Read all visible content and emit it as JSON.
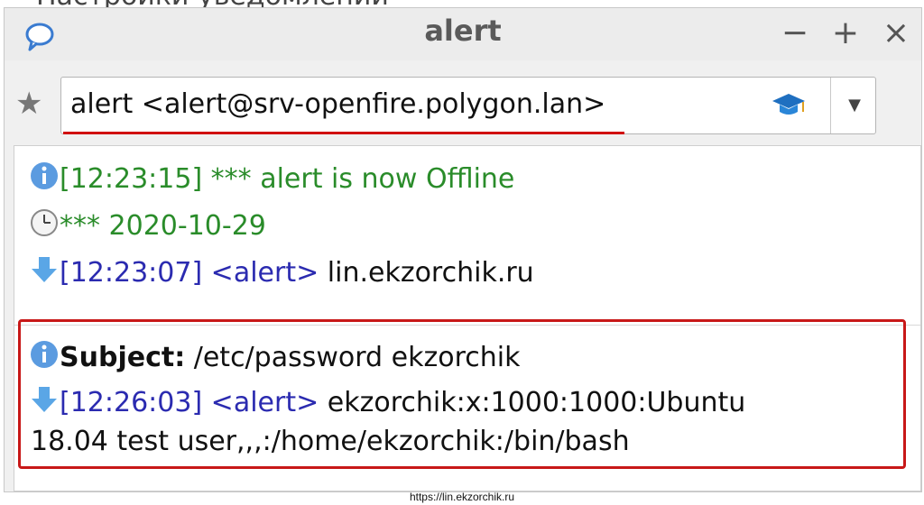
{
  "window": {
    "title": "alert",
    "controls": {
      "minimize": "−",
      "maximize": "+",
      "close": "×"
    }
  },
  "contact": {
    "display": "alert <alert@srv-openfire.polygon.lan>",
    "star_icon": "star-icon",
    "status_icon": "graduation-cap-icon",
    "dropdown_icon": "chevron-down-icon"
  },
  "messages": [
    {
      "icon": "info-icon",
      "text": "[12:23:15] *** alert is now Offline"
    },
    {
      "icon": "clock-icon",
      "text": "*** 2020-10-29"
    },
    {
      "icon": "incoming-arrow-icon",
      "meta": "[12:23:07] <alert>",
      "body": " lin.ekzorchik.ru"
    }
  ],
  "highlighted": {
    "subject_label": "Subject:",
    "subject_value": " /etc/password ekzorchik",
    "message_meta": "[12:26:03] <alert>",
    "message_body_1": " ekzorchik:x:1000:1000:Ubuntu",
    "message_body_2": "18.04 test user,,,:/home/ekzorchik:/bin/bash"
  },
  "footer": {
    "url": "https://lin.ekzorchik.ru"
  },
  "colors": {
    "system_text": "#2a8c2a",
    "nick_text": "#2b2bb0",
    "highlight_border": "#c81818"
  }
}
